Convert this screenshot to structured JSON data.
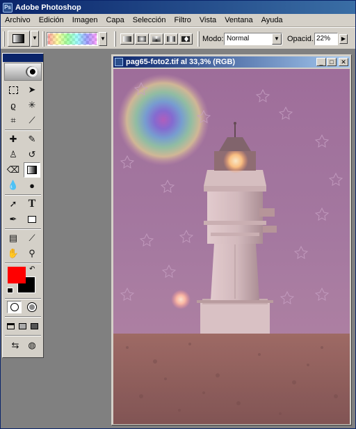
{
  "app": {
    "title": "Adobe Photoshop",
    "icon": "photoshop-icon"
  },
  "menu": [
    "Archivo",
    "Edición",
    "Imagen",
    "Capa",
    "Selección",
    "Filtro",
    "Vista",
    "Ventana",
    "Ayuda"
  ],
  "options": {
    "mode_label": "Modo:",
    "mode_value": "Normal",
    "opacity_label": "Opacid.:",
    "opacity_value": "22%",
    "gradient_types": [
      "linear-gradient-icon",
      "radial-gradient-icon",
      "angle-gradient-icon",
      "reflected-gradient-icon",
      "diamond-gradient-icon"
    ]
  },
  "document": {
    "title": "pag65-foto2.tif al 33,3% (RGB)"
  },
  "colors": {
    "foreground": "#ff0000",
    "background": "#000000",
    "titlebar": "#0a246a",
    "chrome": "#d4d0c8"
  },
  "tools": [
    "marquee-icon",
    "move-icon",
    "lasso-icon",
    "magic-wand-icon",
    "crop-icon",
    "slice-icon",
    "healing-brush-icon",
    "brush-icon",
    "clone-stamp-icon",
    "history-brush-icon",
    "eraser-icon",
    "gradient-icon",
    "blur-icon",
    "dodge-icon",
    "path-selection-icon",
    "type-icon",
    "pen-icon",
    "rectangle-icon",
    "notes-icon",
    "eyedropper-icon",
    "hand-icon",
    "zoom-icon"
  ]
}
